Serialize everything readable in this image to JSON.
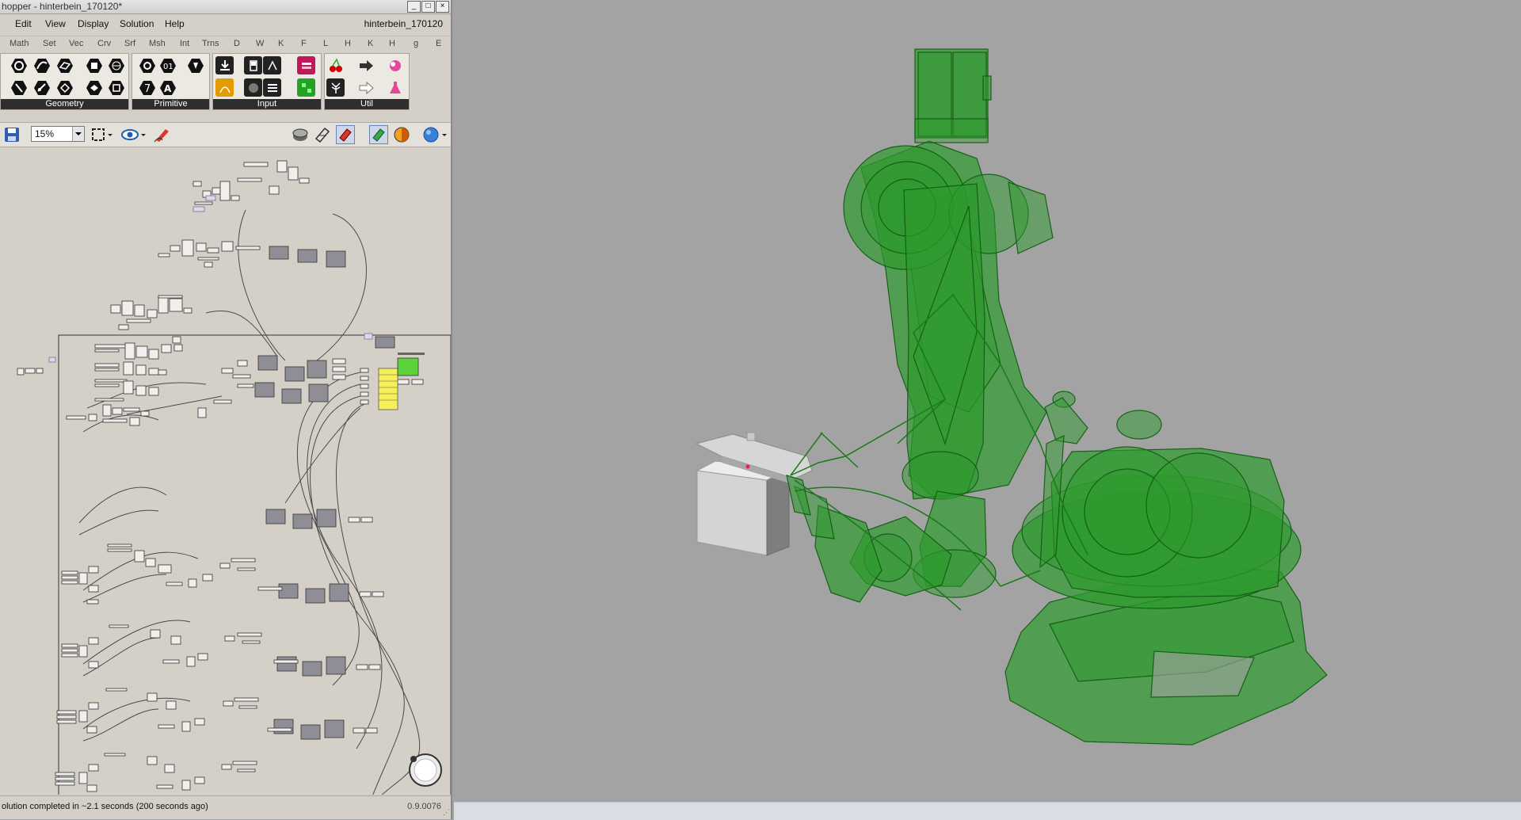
{
  "window": {
    "title": "hopper - hinterbein_170120*",
    "document_name": "hinterbein_170120"
  },
  "menu": [
    "Edit",
    "View",
    "Display",
    "Solution",
    "Help"
  ],
  "tabs": [
    "Math",
    "Set",
    "Vec",
    "Crv",
    "Srf",
    "Msh",
    "Int",
    "Trns",
    "D",
    "W",
    "K",
    "F",
    "L",
    "H",
    "K",
    "H",
    "g",
    "E"
  ],
  "ribbon_groups": [
    "Geometry",
    "Primitive",
    "Input",
    "Util"
  ],
  "zoom": {
    "value": "15%"
  },
  "status": {
    "message": "olution completed in ~2.1 seconds (200 seconds ago)",
    "version": "0.9.0076"
  },
  "colors": {
    "robot_green": "#2e9a2e",
    "viewport_bg": "#a3a3a3",
    "panel_bg": "#d4d0c8",
    "component_grey": "#8f8e96",
    "panel_yellow": "#f5f05a",
    "swatch_green": "#5cd13c"
  },
  "icons": {
    "save": "save-icon",
    "zoom_extents": "zoom-extents-icon",
    "preview": "eye-icon",
    "sketch": "sketch-pen-icon",
    "navigator": "compass-icon"
  }
}
